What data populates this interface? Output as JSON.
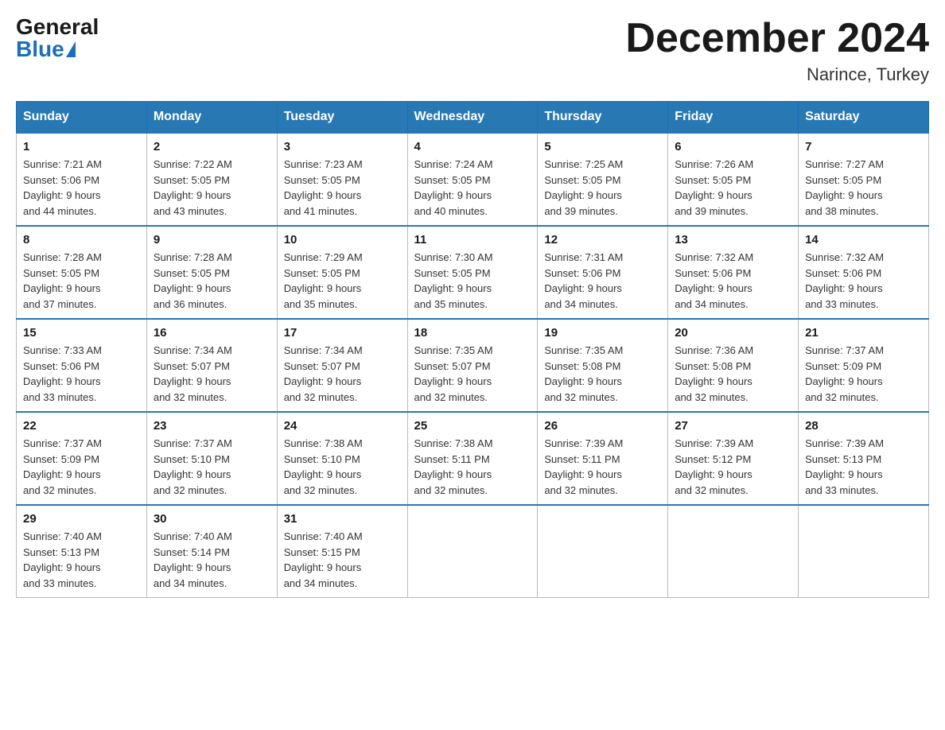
{
  "logo": {
    "general": "General",
    "blue": "Blue"
  },
  "title": {
    "month_year": "December 2024",
    "location": "Narince, Turkey"
  },
  "headers": [
    "Sunday",
    "Monday",
    "Tuesday",
    "Wednesday",
    "Thursday",
    "Friday",
    "Saturday"
  ],
  "weeks": [
    [
      {
        "day": "1",
        "sunrise": "7:21 AM",
        "sunset": "5:06 PM",
        "daylight": "9 hours and 44 minutes."
      },
      {
        "day": "2",
        "sunrise": "7:22 AM",
        "sunset": "5:05 PM",
        "daylight": "9 hours and 43 minutes."
      },
      {
        "day": "3",
        "sunrise": "7:23 AM",
        "sunset": "5:05 PM",
        "daylight": "9 hours and 41 minutes."
      },
      {
        "day": "4",
        "sunrise": "7:24 AM",
        "sunset": "5:05 PM",
        "daylight": "9 hours and 40 minutes."
      },
      {
        "day": "5",
        "sunrise": "7:25 AM",
        "sunset": "5:05 PM",
        "daylight": "9 hours and 39 minutes."
      },
      {
        "day": "6",
        "sunrise": "7:26 AM",
        "sunset": "5:05 PM",
        "daylight": "9 hours and 39 minutes."
      },
      {
        "day": "7",
        "sunrise": "7:27 AM",
        "sunset": "5:05 PM",
        "daylight": "9 hours and 38 minutes."
      }
    ],
    [
      {
        "day": "8",
        "sunrise": "7:28 AM",
        "sunset": "5:05 PM",
        "daylight": "9 hours and 37 minutes."
      },
      {
        "day": "9",
        "sunrise": "7:28 AM",
        "sunset": "5:05 PM",
        "daylight": "9 hours and 36 minutes."
      },
      {
        "day": "10",
        "sunrise": "7:29 AM",
        "sunset": "5:05 PM",
        "daylight": "9 hours and 35 minutes."
      },
      {
        "day": "11",
        "sunrise": "7:30 AM",
        "sunset": "5:05 PM",
        "daylight": "9 hours and 35 minutes."
      },
      {
        "day": "12",
        "sunrise": "7:31 AM",
        "sunset": "5:06 PM",
        "daylight": "9 hours and 34 minutes."
      },
      {
        "day": "13",
        "sunrise": "7:32 AM",
        "sunset": "5:06 PM",
        "daylight": "9 hours and 34 minutes."
      },
      {
        "day": "14",
        "sunrise": "7:32 AM",
        "sunset": "5:06 PM",
        "daylight": "9 hours and 33 minutes."
      }
    ],
    [
      {
        "day": "15",
        "sunrise": "7:33 AM",
        "sunset": "5:06 PM",
        "daylight": "9 hours and 33 minutes."
      },
      {
        "day": "16",
        "sunrise": "7:34 AM",
        "sunset": "5:07 PM",
        "daylight": "9 hours and 32 minutes."
      },
      {
        "day": "17",
        "sunrise": "7:34 AM",
        "sunset": "5:07 PM",
        "daylight": "9 hours and 32 minutes."
      },
      {
        "day": "18",
        "sunrise": "7:35 AM",
        "sunset": "5:07 PM",
        "daylight": "9 hours and 32 minutes."
      },
      {
        "day": "19",
        "sunrise": "7:35 AM",
        "sunset": "5:08 PM",
        "daylight": "9 hours and 32 minutes."
      },
      {
        "day": "20",
        "sunrise": "7:36 AM",
        "sunset": "5:08 PM",
        "daylight": "9 hours and 32 minutes."
      },
      {
        "day": "21",
        "sunrise": "7:37 AM",
        "sunset": "5:09 PM",
        "daylight": "9 hours and 32 minutes."
      }
    ],
    [
      {
        "day": "22",
        "sunrise": "7:37 AM",
        "sunset": "5:09 PM",
        "daylight": "9 hours and 32 minutes."
      },
      {
        "day": "23",
        "sunrise": "7:37 AM",
        "sunset": "5:10 PM",
        "daylight": "9 hours and 32 minutes."
      },
      {
        "day": "24",
        "sunrise": "7:38 AM",
        "sunset": "5:10 PM",
        "daylight": "9 hours and 32 minutes."
      },
      {
        "day": "25",
        "sunrise": "7:38 AM",
        "sunset": "5:11 PM",
        "daylight": "9 hours and 32 minutes."
      },
      {
        "day": "26",
        "sunrise": "7:39 AM",
        "sunset": "5:11 PM",
        "daylight": "9 hours and 32 minutes."
      },
      {
        "day": "27",
        "sunrise": "7:39 AM",
        "sunset": "5:12 PM",
        "daylight": "9 hours and 32 minutes."
      },
      {
        "day": "28",
        "sunrise": "7:39 AM",
        "sunset": "5:13 PM",
        "daylight": "9 hours and 33 minutes."
      }
    ],
    [
      {
        "day": "29",
        "sunrise": "7:40 AM",
        "sunset": "5:13 PM",
        "daylight": "9 hours and 33 minutes."
      },
      {
        "day": "30",
        "sunrise": "7:40 AM",
        "sunset": "5:14 PM",
        "daylight": "9 hours and 34 minutes."
      },
      {
        "day": "31",
        "sunrise": "7:40 AM",
        "sunset": "5:15 PM",
        "daylight": "9 hours and 34 minutes."
      },
      null,
      null,
      null,
      null
    ]
  ],
  "labels": {
    "sunrise": "Sunrise:",
    "sunset": "Sunset:",
    "daylight": "Daylight:"
  }
}
